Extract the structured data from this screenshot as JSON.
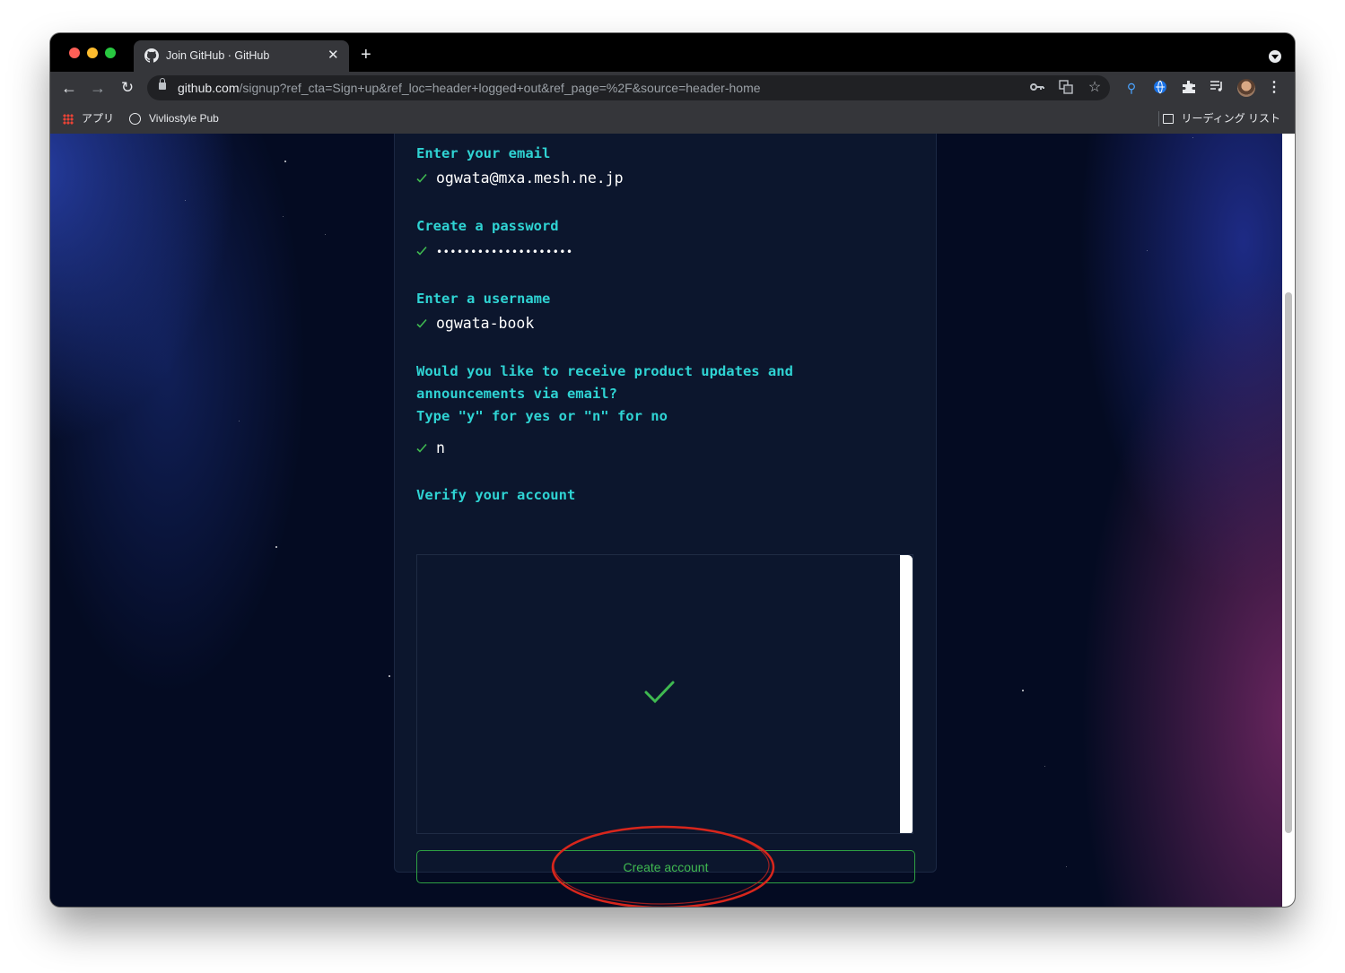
{
  "browser": {
    "tab": {
      "title": "Join GitHub · GitHub",
      "close_label": "✕",
      "new_tab_label": "+"
    },
    "toolbar": {
      "back_label": "←",
      "forward_label": "→",
      "reload_label": "↻",
      "url_host": "github.com",
      "url_path": "/signup?ref_cta=Sign+up&ref_loc=header+logged+out&ref_page=%2F&source=header-home",
      "menu_label": "⋮"
    },
    "bookmarks": {
      "apps_label": "アプリ",
      "vivliostyle_label": "Vivliostyle Pub",
      "reading_list_label": "リーディング リスト"
    }
  },
  "signup": {
    "email": {
      "prompt": "Enter your email",
      "value": "ogwata@mxa.mesh.ne.jp"
    },
    "password": {
      "prompt": "Create a password",
      "value": "••••••••••••••••••••"
    },
    "username": {
      "prompt": "Enter a username",
      "value": "ogwata-book"
    },
    "opt_in": {
      "prompt_line_1": "Would you like to receive product updates and",
      "prompt_line_2": "announcements via email?",
      "prompt_line_3": "Type \"y\" for yes or \"n\" for no",
      "value": "n"
    },
    "verify": {
      "prompt": "Verify your account",
      "status_icon": "check-icon"
    },
    "create_button_label": "Create account"
  },
  "colors": {
    "prompt": "#2fd3d3",
    "check": "#3fb950",
    "button_border": "#2ea043",
    "annotation_ring": "#d8261c"
  }
}
